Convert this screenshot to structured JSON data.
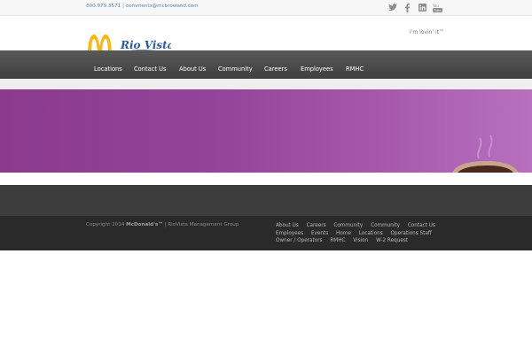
{
  "topbar": {
    "phone": "800.979.3571",
    "separator": "|",
    "email": "comments@mcbrowand.com",
    "social": [
      "twitter-icon",
      "facebook-icon",
      "linkedin-icon",
      "youtube-icon"
    ]
  },
  "header": {
    "logo_text": "Rio Vista",
    "tagline": "i'm lovin' it™"
  },
  "nav": {
    "items": [
      "Locations",
      "Contact Us",
      "About Us",
      "Community",
      "Careers",
      "Employees",
      "RMHC"
    ]
  },
  "footer": {
    "copyright_prefix": "Copyright 2014",
    "brand": "McDonald's™",
    "copyright_suffix": "| RioVista Management Group",
    "links": [
      "About Us",
      "Careers",
      "Community",
      "Community",
      "Contact Us",
      "Employees",
      "Events",
      "Home",
      "Locations",
      "Operations Staff",
      "Owner / Operators",
      "RMHC",
      "Vision",
      "W-2 Request"
    ]
  },
  "colors": {
    "nav_bg": "#4a4a4a",
    "banner": "#93449a",
    "arches": "#f7b81b",
    "logo_text": "#2c5a9e"
  }
}
